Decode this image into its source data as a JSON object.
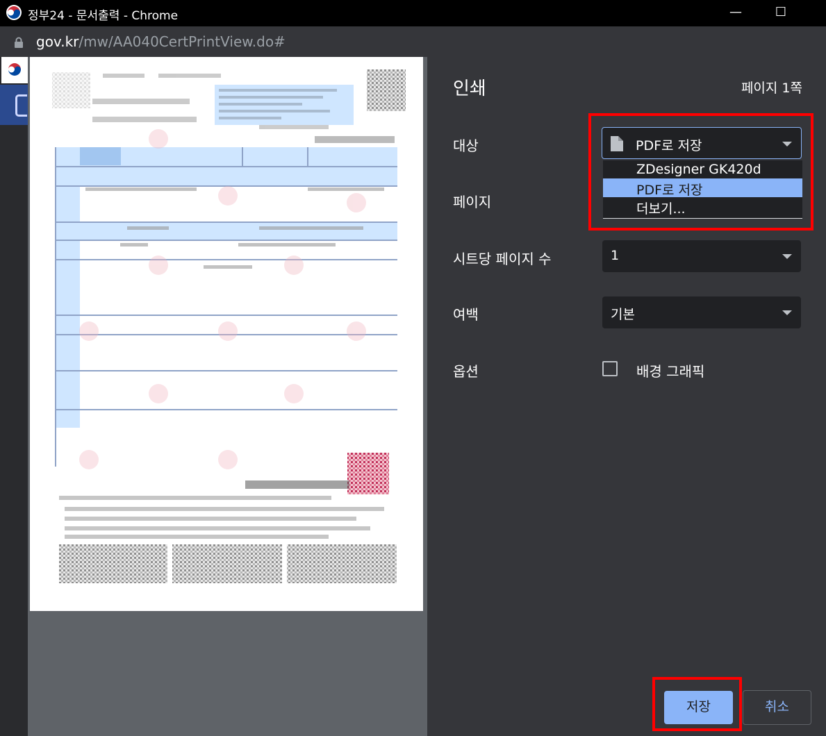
{
  "window": {
    "title": "정부24 - 문서출력 - Chrome",
    "minimize_glyph": "—",
    "maximize_glyph": "☐",
    "close_glyph": "✕"
  },
  "address": {
    "host": "gov.kr",
    "path": "/mw/AA040CertPrintView.do#"
  },
  "print": {
    "title": "인쇄",
    "page_count": "페이지 1쪽",
    "destination": {
      "label": "대상",
      "value": "PDF로 저장",
      "options": [
        "ZDesigner GK420d",
        "PDF로 저장",
        "더보기..."
      ],
      "selected_index": 1
    },
    "pages": {
      "label": "페이지"
    },
    "pages_per_sheet": {
      "label": "시트당 페이지 수",
      "value": "1"
    },
    "margins": {
      "label": "여백",
      "value": "기본"
    },
    "options": {
      "label": "옵션",
      "background_graphics": "배경 그래픽",
      "checked": false
    },
    "save_label": "저장",
    "cancel_label": "취소"
  },
  "colors": {
    "accent": "#8ab4f8",
    "highlight": "#ff0000",
    "panel": "#35363a",
    "background": "#202124"
  }
}
